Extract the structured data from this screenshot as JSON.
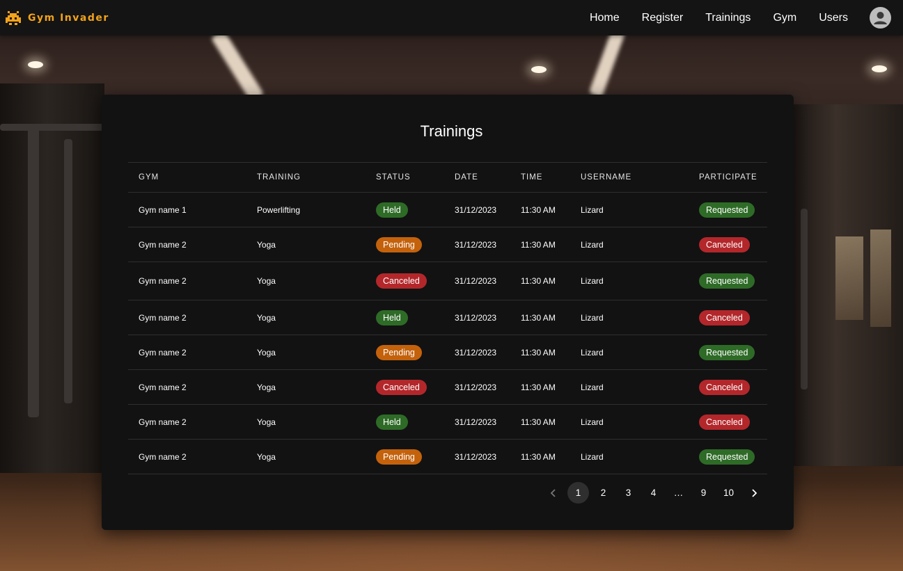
{
  "header": {
    "brand_name": "Gym Invader",
    "brand_icon": "space-invader-icon",
    "brand_color": "#f3a31a",
    "nav": [
      {
        "label": "Home"
      },
      {
        "label": "Register"
      },
      {
        "label": "Trainings"
      },
      {
        "label": "Gym"
      },
      {
        "label": "Users"
      }
    ],
    "account_icon": "account-circle-icon"
  },
  "main": {
    "title": "Trainings",
    "columns": [
      "GYM",
      "TRAINING",
      "STATUS",
      "DATE",
      "TIME",
      "USERNAME",
      "PARTICIPATE"
    ],
    "rows": [
      {
        "gym": "Gym name 1",
        "training": "Powerlifting",
        "status": "Held",
        "date": "31/12/2023",
        "time": "11:30 AM",
        "username": "Lizard",
        "participate": "Requested"
      },
      {
        "gym": "Gym name 2",
        "training": "Yoga",
        "status": "Pending",
        "date": "31/12/2023",
        "time": "11:30 AM",
        "username": "Lizard",
        "participate": "Canceled"
      },
      {
        "gym": "Gym name 2",
        "training": "Yoga",
        "status": "Canceled",
        "date": "31/12/2023",
        "time": "11:30 AM",
        "username": "Lizard",
        "participate": "Requested"
      },
      {
        "gym": "Gym name 2",
        "training": "Yoga",
        "status": "Held",
        "date": "31/12/2023",
        "time": "11:30 AM",
        "username": "Lizard",
        "participate": "Canceled"
      },
      {
        "gym": "Gym name 2",
        "training": "Yoga",
        "status": "Pending",
        "date": "31/12/2023",
        "time": "11:30 AM",
        "username": "Lizard",
        "participate": "Requested"
      },
      {
        "gym": "Gym name 2",
        "training": "Yoga",
        "status": "Canceled",
        "date": "31/12/2023",
        "time": "11:30 AM",
        "username": "Lizard",
        "participate": "Canceled"
      },
      {
        "gym": "Gym name 2",
        "training": "Yoga",
        "status": "Held",
        "date": "31/12/2023",
        "time": "11:30 AM",
        "username": "Lizard",
        "participate": "Canceled"
      },
      {
        "gym": "Gym name 2",
        "training": "Yoga",
        "status": "Pending",
        "date": "31/12/2023",
        "time": "11:30 AM",
        "username": "Lizard",
        "participate": "Requested"
      }
    ],
    "status_colors": {
      "Held": "#2e6b27",
      "Requested": "#2e6b27",
      "Pending": "#c4620c",
      "Canceled": "#b3272b"
    }
  },
  "pagination": {
    "prev_icon": "chevron-left-icon",
    "next_icon": "chevron-right-icon",
    "pages": [
      "1",
      "2",
      "3",
      "4",
      "…",
      "9",
      "10"
    ],
    "current": "1"
  }
}
